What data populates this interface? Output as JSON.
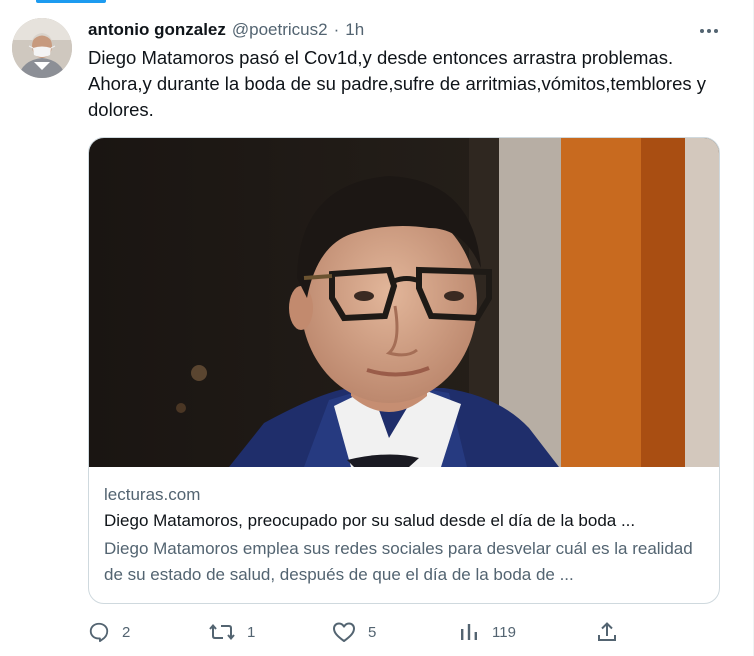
{
  "tweet": {
    "author_name": "antonio gonzalez",
    "author_handle": "@poetricus2",
    "separator": "·",
    "time": "1h",
    "text": "Diego Matamoros pasó el Cov1d,y desde entonces arrastra problemas. Ahora,y durante la boda de su padre,sufre de arritmias,vómitos,temblores y dolores."
  },
  "card": {
    "domain": "lecturas.com",
    "title": "Diego Matamoros, preocupado por su salud desde el día de la boda ...",
    "description": "Diego Matamoros emplea sus redes sociales para desvelar cuál es la realidad de su estado de salud, después de que el día de la boda de ..."
  },
  "actions": {
    "replies": "2",
    "retweets": "1",
    "likes": "5",
    "views": "119"
  },
  "icons": {
    "more": "more-icon",
    "reply": "reply-icon",
    "retweet": "retweet-icon",
    "like": "heart-icon",
    "views": "views-icon",
    "share": "share-icon"
  },
  "colors": {
    "text": "#0f1419",
    "secondary": "#536471",
    "border": "#cfd9de",
    "accent": "#1d9bf0"
  }
}
